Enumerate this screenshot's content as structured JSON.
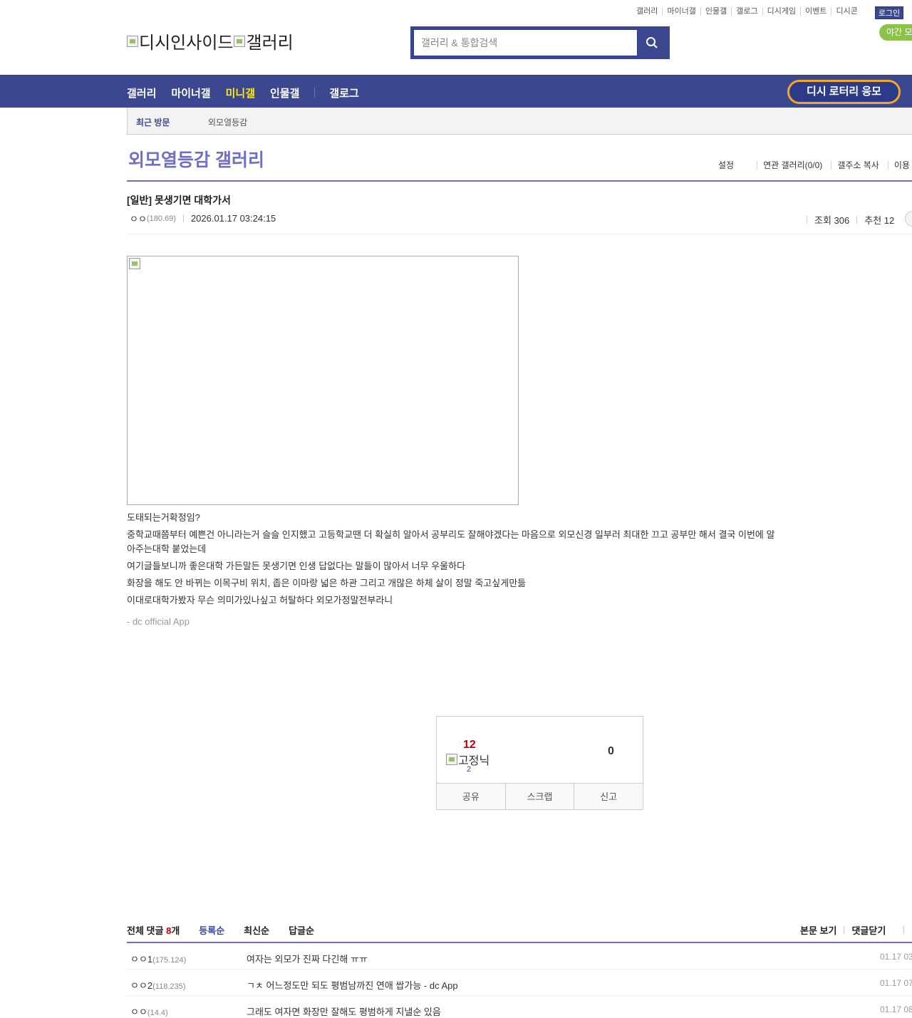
{
  "util_links": [
    "갤러리",
    "마이너갤",
    "인물갤",
    "갤로그",
    "디시게임",
    "이벤트",
    "디시콘"
  ],
  "login_label": "로그인",
  "night_mode_label": "야간 모",
  "logo": {
    "site_alt": "디시인사이드",
    "gallery_alt": "갤러리"
  },
  "search": {
    "placeholder": "갤러리 & 통합검색"
  },
  "nav": {
    "gallery": "갤러리",
    "minor": "마이너갤",
    "mini": "미니갤",
    "person": "인물갤",
    "gallog": "갤로그",
    "lottery": "디시 로터리 응모"
  },
  "recent": {
    "label": "최근 방문",
    "item": "외모열등감"
  },
  "gallery_title": "외모열등감 갤러리",
  "gallery_menu": {
    "settings": "설정",
    "related": "연관 갤러리(0/0)",
    "copy_addr": "갤주소 복사",
    "usage": "이용"
  },
  "post": {
    "title": "[일반] 못생기면 대학가서",
    "author": "ㅇㅇ",
    "ip": "(180.69)",
    "datetime": "2026.01.17 03:24:15",
    "views": "조회 306",
    "recommends": "추천 12",
    "lines": [
      "도태되는거확정임?",
      "중학교때쯤부터 예쁜건 아니라는거 슬슬 인지했고 고등학교땐 더 확실히 알아서 공부리도 잘해야겠다는 마음으로 외모신경 일부러 최대한 끄고 공부만 해서 결국 이번에 알아주는대학 붙었는데",
      "여기글들보니까 좋은대학 가든말든 못생기면 인생 답없다는 말들이 많아서 너무 우울하다",
      "화장을 해도 안 바뀌는 이목구비 위치, 좁은 이마랑 넓은 하관 그리고 개많은 하체 살이 정말 죽고싶게만듦",
      "이대로대학가봤자 무슨 의미가있나싶고 허탈하다 외모가정말전부라니"
    ],
    "app_signature": "- dc official App"
  },
  "vote": {
    "up_count": "12",
    "fixnick_alt": "고정닉",
    "fixnick_count": "2",
    "down_count": "0",
    "share": "공유",
    "scrap": "스크랩",
    "report": "신고"
  },
  "comments_header": {
    "total_prefix": "전체 댓글 ",
    "total_count": "8",
    "total_suffix": "개",
    "sort_registered": "등록순",
    "sort_latest": "최신순",
    "sort_reply": "답글순",
    "view_body": "본문 보기",
    "close_comments": "댓글닫기"
  },
  "comments": [
    {
      "nick": "ㅇㅇ1",
      "ip": "(175.124)",
      "text": "여자는 외모가 진짜 다긴해 ㅠㅠ",
      "date": "01.17 03"
    },
    {
      "nick": "ㅇㅇ2",
      "ip": "(118.235)",
      "text": "ㄱㅊ 어느정도만 되도 평범남까진 연애 쌉가능 - dc App",
      "date": "01.17 07"
    },
    {
      "nick": "ㅇㅇ",
      "ip": "(14.4)",
      "text": "그래도 여자면 화장만 잘해도 평범하게 지낼순 있음",
      "date": "01.17 08"
    }
  ]
}
